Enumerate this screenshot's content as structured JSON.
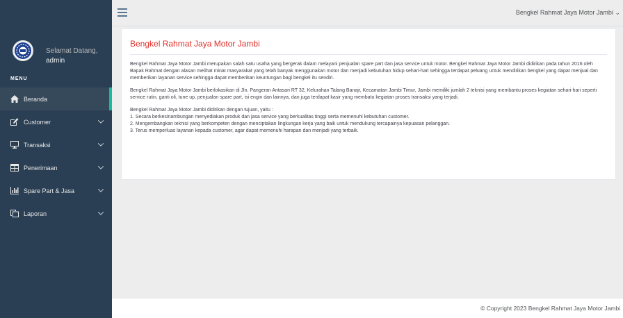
{
  "sidebar": {
    "welcome": "Selamat Datang,",
    "username": "admin",
    "menu_title": "MENU",
    "items": [
      {
        "label": "Beranda",
        "icon": "home-icon"
      },
      {
        "label": "Customer",
        "icon": "edit-icon"
      },
      {
        "label": "Transaksi",
        "icon": "desktop-icon"
      },
      {
        "label": "Penerimaan",
        "icon": "table-icon"
      },
      {
        "label": "Spare Part & Jasa",
        "icon": "bar-chart-icon"
      },
      {
        "label": "Laporan",
        "icon": "copy-icon"
      }
    ]
  },
  "header": {
    "user_menu": "Bengkel Rahmat Jaya Motor Jambi"
  },
  "main": {
    "title": "Bengkel Rahmat Jaya Motor Jambi",
    "paragraph1": "Bengkel Rahmat Jaya Motor Jambi merupakan salah satu usaha yang bergerak dalam melayani penjualan spare part dan jasa service untuk motor. Bengkel Rahmat Jaya Motor Jambi didirikan pada tahun 2016 oleh Bapak Rahmat dengan alasan melihat minat masyarakat yang telah banyak menggunakan motor dan menjadi kebutuhan hidup sehari-hari sehingga terdapat peluang untuk mendirikan bengkel yang dapat menjual dan memberikan layanan service sehingga dapat memberikan keuntungan bagi bengkel itu sendiri.",
    "paragraph2": "Bengkel Rahmat Jaya Motor Jambi berlokasikan di Jln. Pangeran Antasari RT 32, Kelurahan Talang Banajr, Kecamatan Jambi Timur, Jambi memiliki jumlah 2 teknisi yang membantu proses kegiatan sehari-hari seperti service rutin, ganti oli, tune up, penjualan spare part, isi engin dan lainnya, dan juga terdapat kasir yang membatu kegiatan proses transaksi yang terjadi.",
    "goals_intro": "Bengkel Rahmat Jaya Motor Jambi didirikan dengan tujuan, yaitu :",
    "goal1": "1. Secara berkesinambungan menyediakan produk dan jasa service yang berkualitas tinggi serta memenuhi kebutuhan customer.",
    "goal2": "2. Mengembangkan teknisi yang berkompeten dengan menciptakan lingkungan kerja yang baik untuk mendukung tercapainya kepuasan pelanggan.",
    "goal3": "3. Terus memperluas layanan kepada customer, agar dapat memenuhi harapan dan menjadi yang terbaik."
  },
  "footer": {
    "copyright": "© Copyright 2023 Bengkel Rahmat Jaya Motor Jambi"
  },
  "colors": {
    "sidebar_bg": "#2a3f54",
    "active_accent": "#1abb9c",
    "title_red": "#e0302a"
  }
}
